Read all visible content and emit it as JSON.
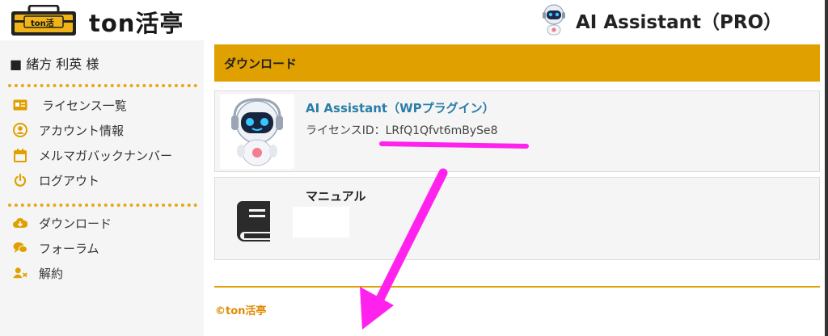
{
  "header": {
    "logo_badge": "ton活",
    "site_name": "ton活亭",
    "app_title": "AI Assistant（PRO）"
  },
  "sidebar": {
    "user_name": "■ 緒方 利英 様",
    "group1": [
      {
        "label": "ライセンス一覧",
        "icon": "id-card-icon"
      },
      {
        "label": "アカウント情報",
        "icon": "user-circle-icon"
      },
      {
        "label": "メルマガバックナンバー",
        "icon": "calendar-icon"
      },
      {
        "label": "ログアウト",
        "icon": "power-icon"
      }
    ],
    "group2": [
      {
        "label": "ダウンロード",
        "icon": "cloud-download-icon"
      },
      {
        "label": "フォーラム",
        "icon": "chat-bubbles-icon"
      },
      {
        "label": "解約",
        "icon": "user-remove-icon"
      }
    ]
  },
  "main": {
    "section_title": "ダウンロード",
    "product": {
      "title": "AI Assistant（WPプラグイン）",
      "license": "ライセンスID：LRfQ1Qfvt6mBySe8"
    },
    "manual": {
      "title": "マニュアル"
    }
  },
  "footer": {
    "copyright": "©ton活亭"
  },
  "colors": {
    "accent": "#e0a000",
    "link": "#2a7ea8",
    "annotation": "#ff22ee",
    "sidebar_bg": "#f5f5f5"
  }
}
